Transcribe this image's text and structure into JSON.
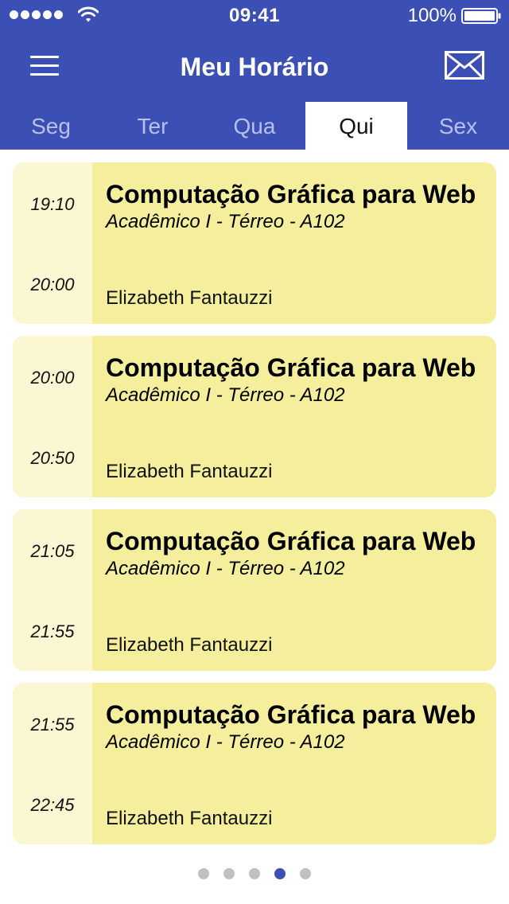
{
  "status_bar": {
    "time": "09:41",
    "battery": "100%",
    "signal_icon": "signal-dots-icon",
    "wifi_icon": "wifi-icon",
    "battery_icon": "battery-icon"
  },
  "nav": {
    "title": "Meu Horário",
    "menu_icon": "hamburger-menu-icon",
    "mail_icon": "envelope-icon"
  },
  "tabs": [
    {
      "label": "Seg",
      "active": false
    },
    {
      "label": "Ter",
      "active": false
    },
    {
      "label": "Qua",
      "active": false
    },
    {
      "label": "Qui",
      "active": true
    },
    {
      "label": "Sex",
      "active": false
    }
  ],
  "classes": [
    {
      "start": "19:10",
      "end": "20:00",
      "course": "Computação Gráfica para Web",
      "location": "Acadêmico I - Térreo - A102",
      "teacher": "Elizabeth Fantauzzi"
    },
    {
      "start": "20:00",
      "end": "20:50",
      "course": "Computação Gráfica para Web",
      "location": "Acadêmico I - Térreo - A102",
      "teacher": "Elizabeth Fantauzzi"
    },
    {
      "start": "21:05",
      "end": "21:55",
      "course": "Computação Gráfica para Web",
      "location": "Acadêmico I - Térreo - A102",
      "teacher": "Elizabeth Fantauzzi"
    },
    {
      "start": "21:55",
      "end": "22:45",
      "course": "Computação Gráfica para Web",
      "location": "Acadêmico I - Térreo - A102",
      "teacher": "Elizabeth Fantauzzi"
    }
  ],
  "page_indicator": {
    "pages": 5,
    "current_page": 4
  },
  "colors": {
    "primary": "#3b4fb5",
    "card_background": "#f5ef9d",
    "time_background": "#fbf7d3",
    "inactive_tab_text": "#b8c1ec",
    "inactive_dot": "#c0c0c0"
  }
}
